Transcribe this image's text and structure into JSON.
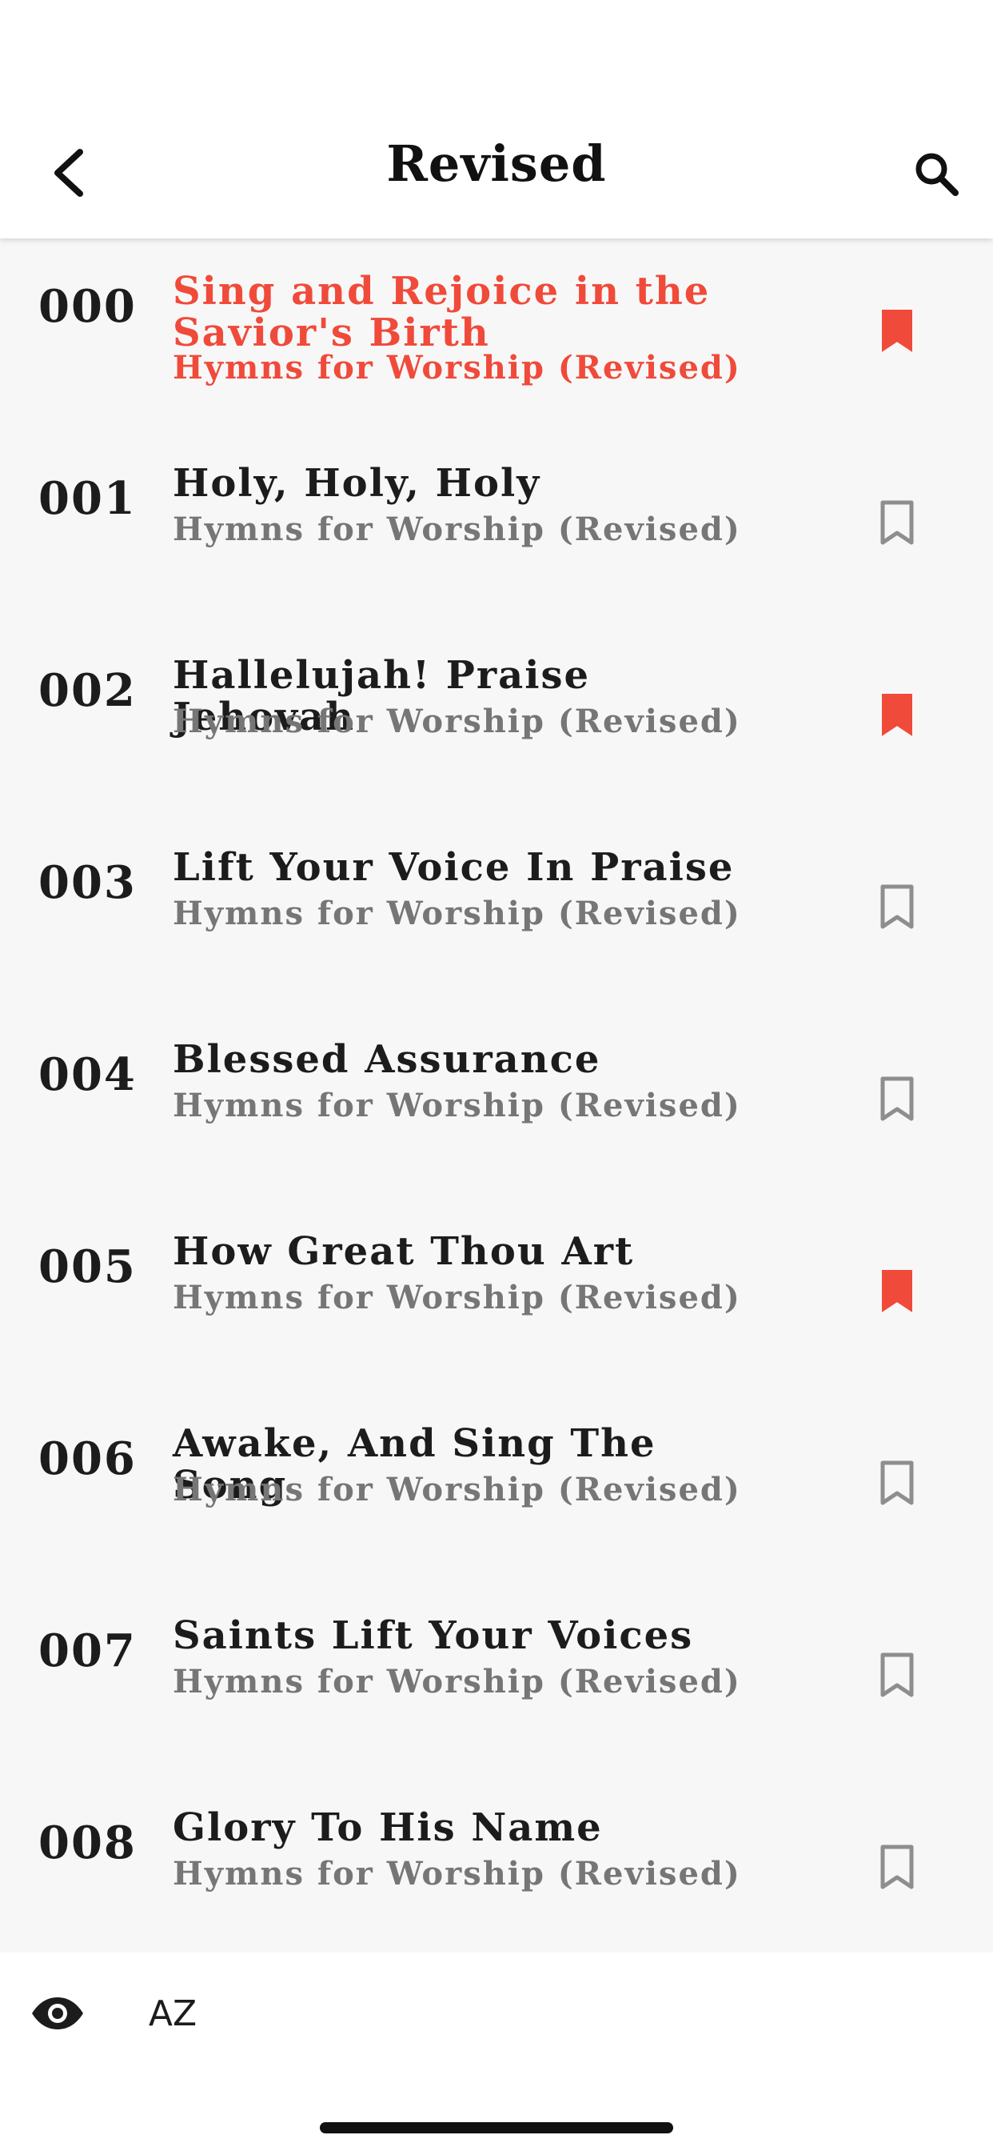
{
  "header": {
    "title": "Revised",
    "back_icon": "chevron-left-icon",
    "search_icon": "search-icon"
  },
  "colors": {
    "accent": "#f04a3a",
    "text": "#1c1c1c",
    "subtext": "#767676",
    "bookmark_outline": "#8e8e8e"
  },
  "hymns": [
    {
      "number": "000",
      "title": "Sing and Rejoice in the Savior's Birth",
      "book": "Hymns for Worship (Revised)",
      "bookmarked": true,
      "active": true
    },
    {
      "number": "001",
      "title": "Holy, Holy, Holy",
      "book": "Hymns for Worship (Revised)",
      "bookmarked": false,
      "active": false
    },
    {
      "number": "002",
      "title": "Hallelujah! Praise Jehovah",
      "book": "Hymns for Worship (Revised)",
      "bookmarked": true,
      "active": false
    },
    {
      "number": "003",
      "title": "Lift Your Voice In Praise",
      "book": "Hymns for Worship (Revised)",
      "bookmarked": false,
      "active": false
    },
    {
      "number": "004",
      "title": "Blessed Assurance",
      "book": "Hymns for Worship (Revised)",
      "bookmarked": false,
      "active": false
    },
    {
      "number": "005",
      "title": "How Great Thou Art",
      "book": "Hymns for Worship (Revised)",
      "bookmarked": true,
      "active": false
    },
    {
      "number": "006",
      "title": "Awake, And Sing The Song",
      "book": "Hymns for Worship (Revised)",
      "bookmarked": false,
      "active": false
    },
    {
      "number": "007",
      "title": "Saints Lift Your Voices",
      "book": "Hymns for Worship (Revised)",
      "bookmarked": false,
      "active": false
    },
    {
      "number": "008",
      "title": "Glory To His Name",
      "book": "Hymns for Worship (Revised)",
      "bookmarked": false,
      "active": false
    }
  ],
  "footer": {
    "eye_icon": "eye-icon",
    "sort_label": "AZ",
    "sort_icon": "sort-az-icon"
  }
}
